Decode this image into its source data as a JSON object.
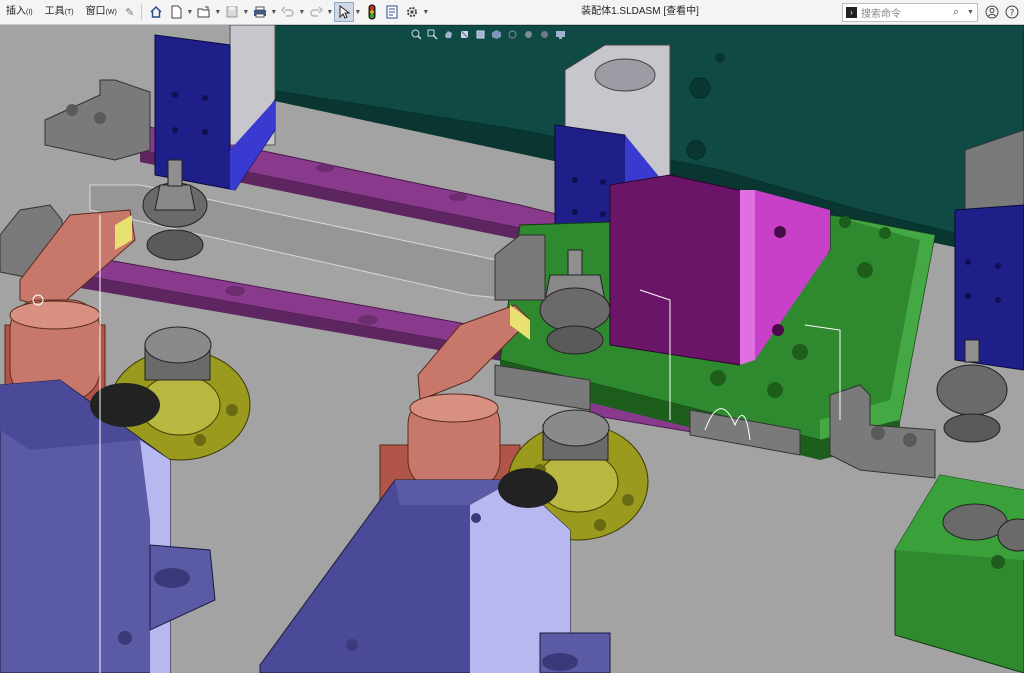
{
  "menu": {
    "items": [
      {
        "label": "插入",
        "shortcut": "(I)"
      },
      {
        "label": "工具",
        "shortcut": "(T)"
      },
      {
        "label": "窗口",
        "shortcut": "(W)"
      }
    ]
  },
  "toolbar": {
    "icons": [
      "home-icon",
      "new-document-icon",
      "open-folder-icon",
      "save-icon",
      "print-icon",
      "undo-icon",
      "redo-icon",
      "select-arrow-icon",
      "traffic-light-icon",
      "file-properties-icon",
      "options-gear-icon"
    ]
  },
  "window": {
    "title": "装配体1.SLDASM [查看中]"
  },
  "search": {
    "placeholder": "搜索命令"
  },
  "colors": {
    "background": "#a3a3a3",
    "teal_plate": "#0f4a44",
    "purple_rail": "#8a3a8c",
    "blue_block": "#1f1f8a",
    "green_plate": "#2f8a2f",
    "copper_clamp": "#c8786a",
    "olive_flange": "#9a9a1e",
    "motor_lavender": "#5a5aa5"
  }
}
